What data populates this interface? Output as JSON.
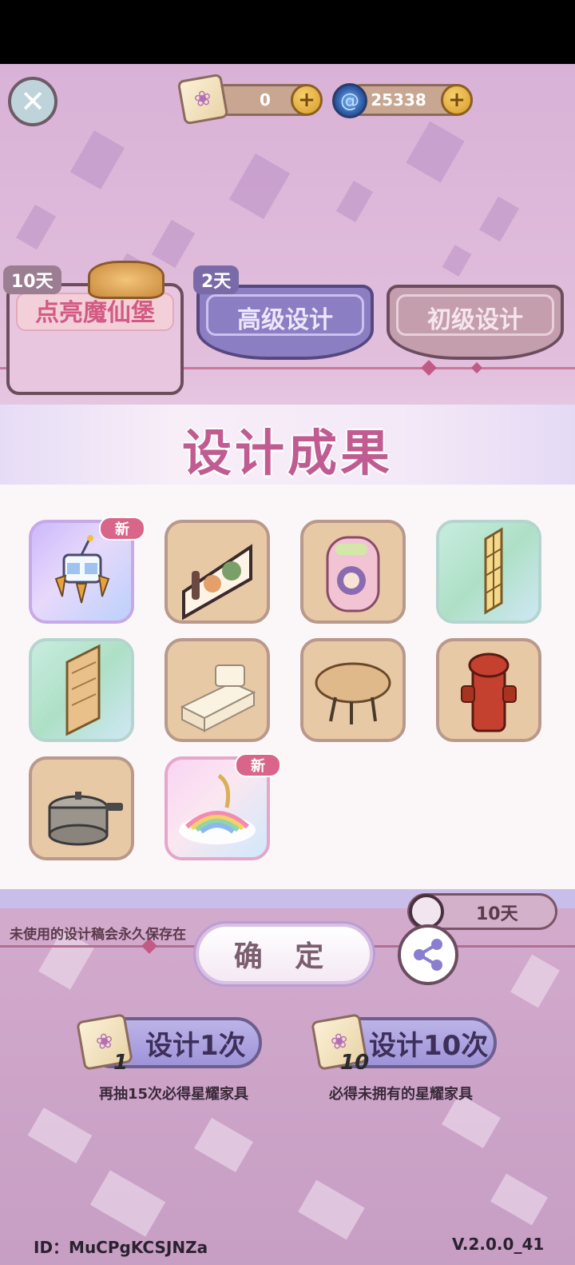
{
  "header": {
    "close_icon": "close-icon",
    "currency_1": {
      "icon": "design-scroll-icon",
      "value": "0",
      "plus_icon": "plus-icon"
    },
    "currency_2": {
      "icon": "swirl-gem-icon",
      "value": "25338",
      "plus_icon": "plus-icon"
    }
  },
  "tabs": [
    {
      "label": "点亮魔仙堡",
      "badge": "10天"
    },
    {
      "label": "高级设计",
      "badge": "2天"
    },
    {
      "label": "初级设计",
      "badge": ""
    }
  ],
  "result_panel": {
    "title": "设计成果",
    "items": [
      {
        "name": "hover-drone-furniture",
        "icon": "drone-icon",
        "new_badge": "新",
        "rarity": "purple"
      },
      {
        "name": "wall-shelf-bottles",
        "icon": "bottle-shelf-icon",
        "new_badge": "",
        "rarity": "normal"
      },
      {
        "name": "pink-backpack",
        "icon": "backpack-icon",
        "new_badge": "",
        "rarity": "normal"
      },
      {
        "name": "yellow-window",
        "icon": "window-icon",
        "new_badge": "",
        "rarity": "green"
      },
      {
        "name": "wooden-stair-door",
        "icon": "door-icon",
        "new_badge": "",
        "rarity": "green"
      },
      {
        "name": "white-sink-counter",
        "icon": "sink-icon",
        "new_badge": "",
        "rarity": "normal"
      },
      {
        "name": "oval-table",
        "icon": "table-icon",
        "new_badge": "",
        "rarity": "normal"
      },
      {
        "name": "fire-hydrant",
        "icon": "hydrant-icon",
        "new_badge": "",
        "rarity": "normal"
      },
      {
        "name": "pressure-cooker",
        "icon": "cooker-icon",
        "new_badge": "",
        "rarity": "normal"
      },
      {
        "name": "rainbow-bed",
        "icon": "rainbow-bed-icon",
        "new_badge": "新",
        "rarity": "rainbow"
      }
    ]
  },
  "info_text": "未使用的设计稿会永久保存在",
  "timer_text": "10天",
  "confirm_label": "确 定",
  "share_icon": "share-icon",
  "draw_buttons": [
    {
      "label": "设计1次",
      "count": "1",
      "sub": "再抽15次必得星耀家具"
    },
    {
      "label": "设计10次",
      "count": "10",
      "sub": "必得未拥有的星耀家具"
    }
  ],
  "footer": {
    "id_text": "ID：MuCPgKCSJNZa",
    "version": "V.2.0.0_41"
  }
}
